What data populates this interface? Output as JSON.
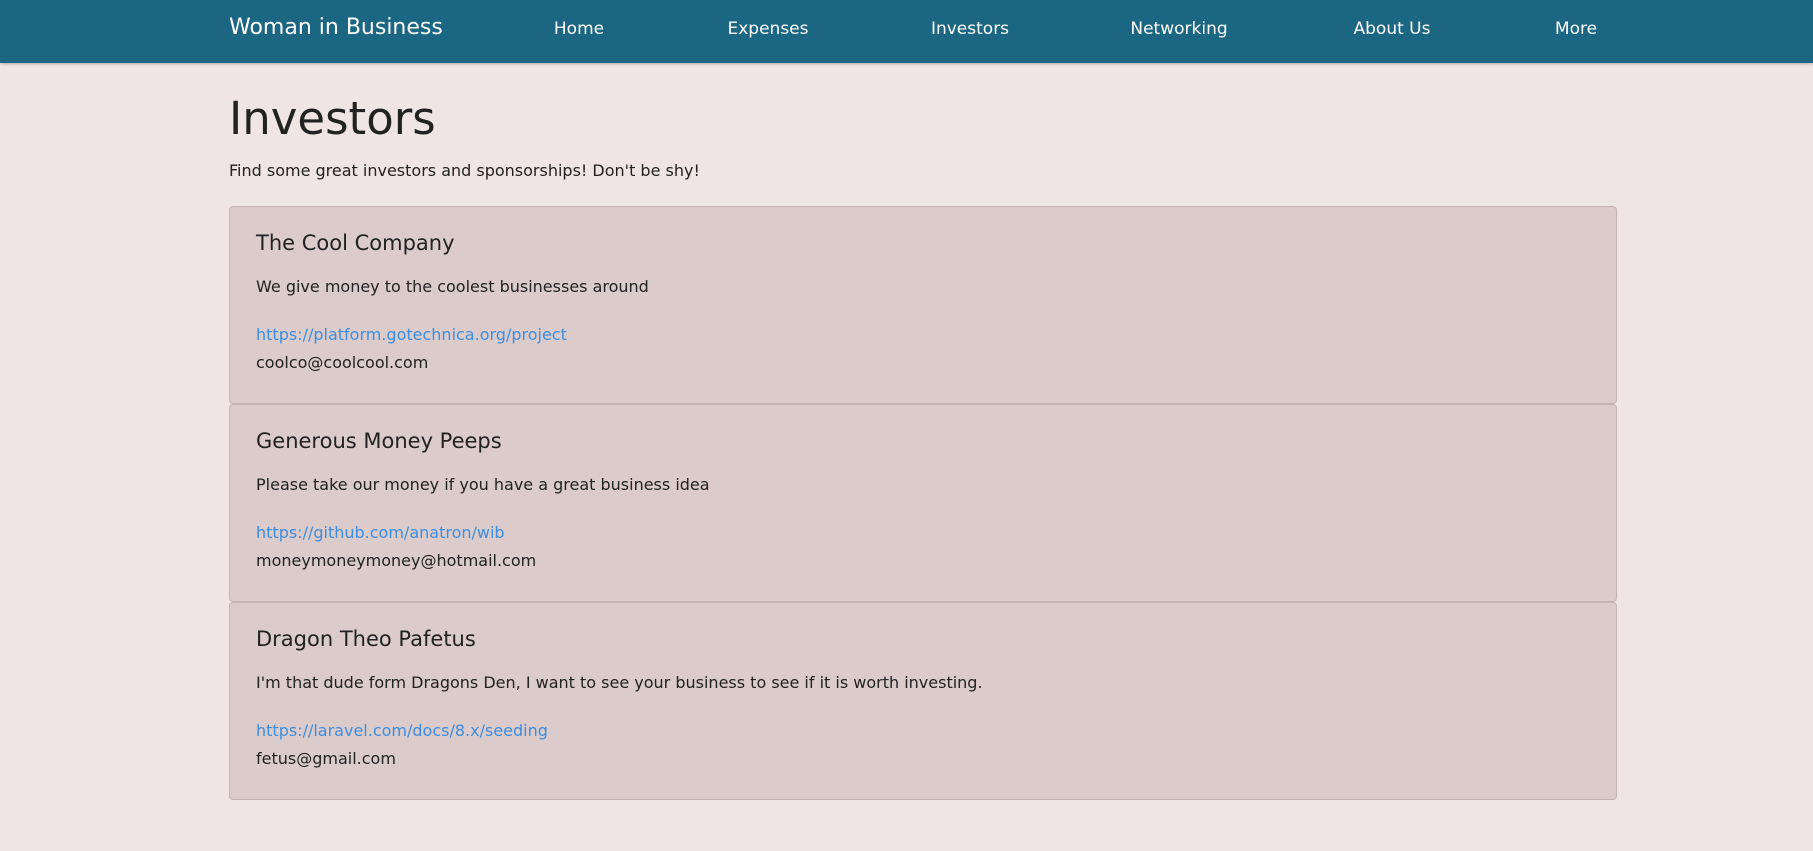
{
  "nav": {
    "brand": "Woman in Business",
    "links": [
      {
        "label": "Home"
      },
      {
        "label": "Expenses"
      },
      {
        "label": "Investors"
      },
      {
        "label": "Networking"
      },
      {
        "label": "About Us"
      },
      {
        "label": "More"
      }
    ]
  },
  "page": {
    "title": "Investors",
    "subtitle": "Find some great investors and sponsorships! Don't be shy!"
  },
  "investors": [
    {
      "name": "The Cool Company",
      "description": "We give money to the coolest businesses around",
      "link": "https://platform.gotechnica.org/project",
      "email": "coolco@coolcool.com"
    },
    {
      "name": "Generous Money Peeps",
      "description": "Please take our money if you have a great business idea",
      "link": "https://github.com/anatron/wib",
      "email": "moneymoneymoney@hotmail.com"
    },
    {
      "name": "Dragon Theo Pafetus",
      "description": "I'm that dude form Dragons Den, I want to see your business to see if it is worth investing.",
      "link": "https://laravel.com/docs/8.x/seeding",
      "email": "fetus@gmail.com"
    }
  ],
  "colors": {
    "navbar": "#1b6682",
    "background": "#efe5e4",
    "card": "#dccbcb",
    "link": "#3d8ee0"
  }
}
